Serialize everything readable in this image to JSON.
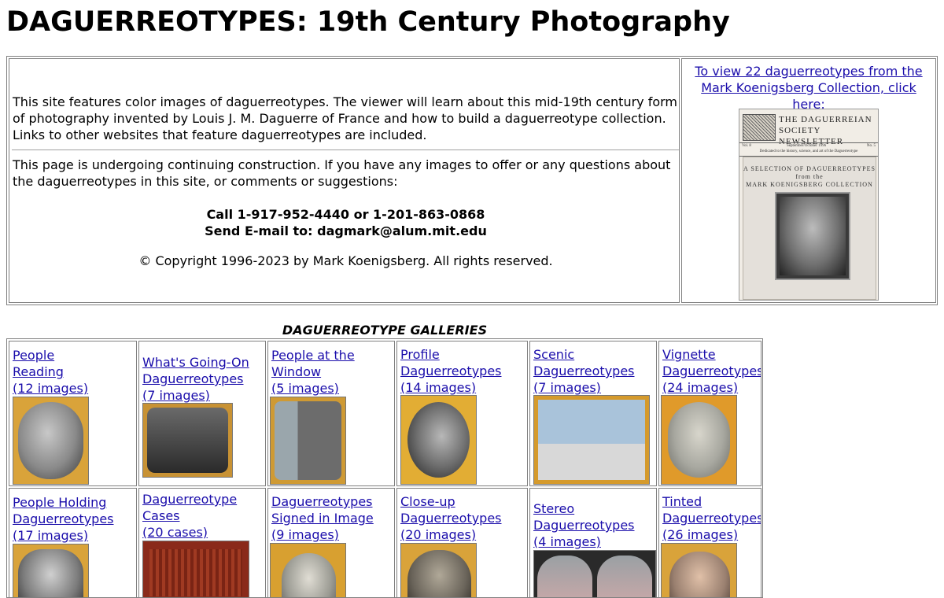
{
  "header": {
    "title": "DAGUERREOTYPES: 19th Century Photography"
  },
  "intro": {
    "paragraph1": "This site features color images of daguerreotypes. The viewer will learn about this mid-19th century form of photography invented by Louis J. M. Daguerre of France and how to build a daguerreotype collection. Links to other websites that feature daguerreotypes are included.",
    "paragraph2": "This page is undergoing continuing construction. If you have any images to offer or any questions about the daguerreotypes in this site, or comments or suggestions:",
    "phone": "Call 1-917-952-4440 or 1-201-863-0868",
    "email": "Send E-mail to: dagmark@alum.mit.edu",
    "copyright": "© Copyright 1996-2023 by Mark Koenigsberg. All rights reserved."
  },
  "sidebar": {
    "link_text": "To view 22 daguerreotypes from the Mark Koenigsberg Collection, click here:",
    "newsletter": {
      "title_line1": "THE DAGUERREIAN",
      "title_line2": "SOCIETY NEWSLETTER",
      "band_left": "Vol. 8",
      "band_mid": "September/October 1996",
      "band_right": "No. 5",
      "band_line2": "Dedicated to the history, science, and art of the Daguerreotype",
      "selection_line1": "A SELECTION OF DAGUERREOTYPES",
      "selection_line2": "from the",
      "selection_line3": "MARK KOENIGSBERG COLLECTION"
    }
  },
  "galleries": {
    "title": "DAGUERREOTYPE GALLERIES",
    "row1": [
      {
        "line1": "People",
        "line2": "Reading",
        "count": "(12 images)"
      },
      {
        "line1": "What's Going-On",
        "line2": "Daguerreotypes",
        "count": "(7 images)"
      },
      {
        "line1": "People at the",
        "line2": "Window",
        "count": "(5 images)"
      },
      {
        "line1": "Profile",
        "line2": "Daguerreotypes",
        "count": "(14 images)"
      },
      {
        "line1": "Scenic",
        "line2": "Daguerreotypes",
        "count": "(7 images)"
      },
      {
        "line1": "Vignette",
        "line2": "Daguerreotypes",
        "count": "(24 images)"
      }
    ],
    "row2": [
      {
        "line1": "People Holding",
        "line2": "Daguerreotypes",
        "count": "(17 images)"
      },
      {
        "line1": "Daguerreotype",
        "line2": "Cases",
        "count": "(20 cases)"
      },
      {
        "line1": "Daguerreotypes",
        "line2": "Signed in Image",
        "count": "(9 images)"
      },
      {
        "line1": "Close-up",
        "line2": "Daguerreotypes",
        "count": "(20 images)"
      },
      {
        "line1": "Stereo",
        "line2": "Daguerreotypes",
        "count": "(4 images)"
      },
      {
        "line1": "Tinted",
        "line2": "Daguerreotypes",
        "count": "(26 images)"
      }
    ]
  },
  "colors": {
    "link": "#1a0dab",
    "border": "#808080",
    "thumb_gold": "#d9a33a"
  }
}
